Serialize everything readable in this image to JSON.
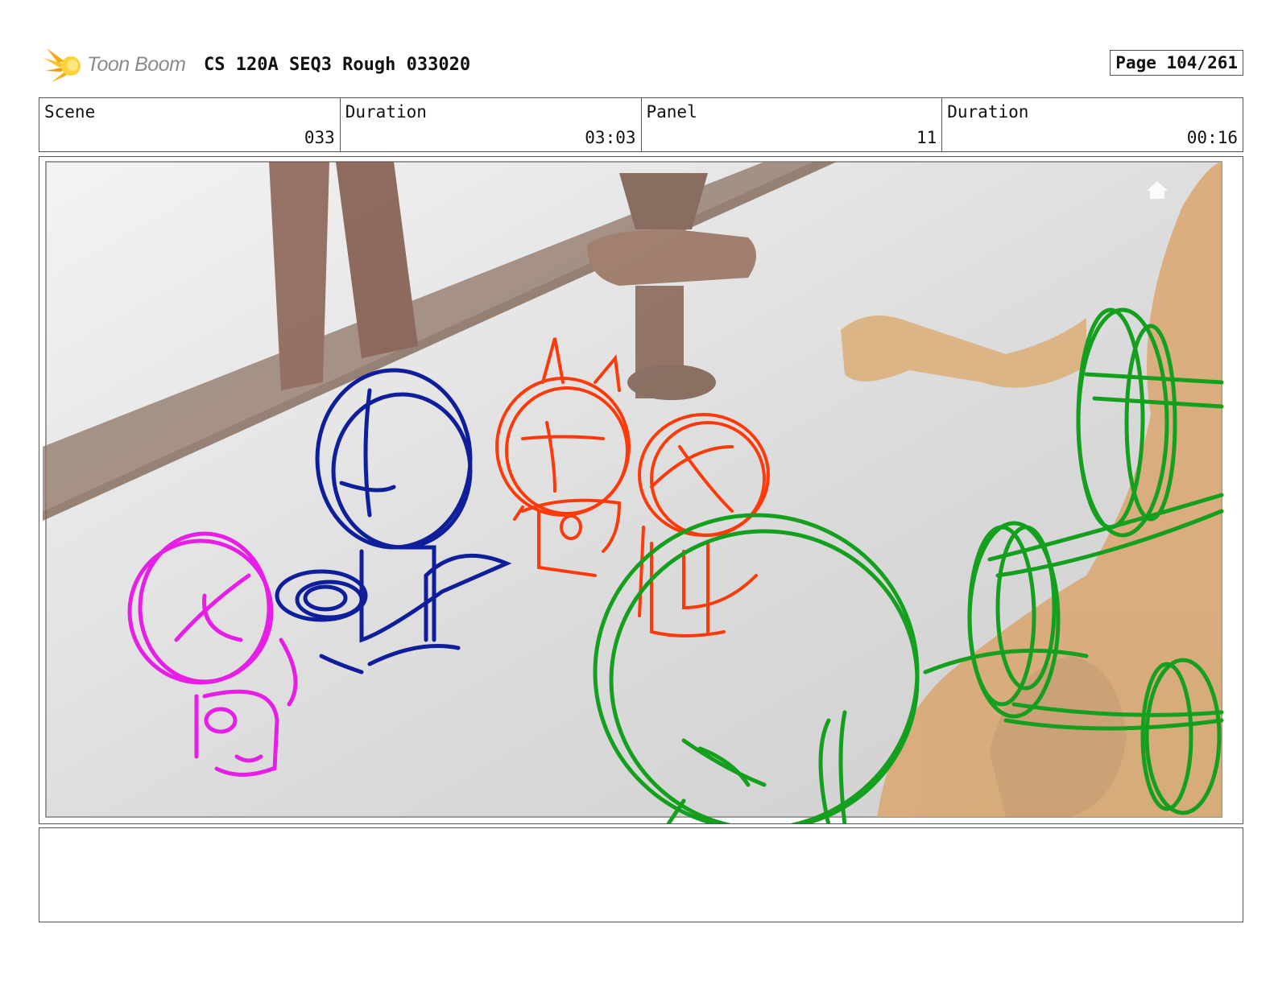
{
  "header": {
    "logo_text": "Toon Boom",
    "title": "CS 120A SEQ3 Rough 033020",
    "page": "Page 104/261"
  },
  "info": [
    {
      "label": "Scene",
      "value": "033"
    },
    {
      "label": "Duration",
      "value": "03:03"
    },
    {
      "label": "Panel",
      "value": "11"
    },
    {
      "label": "Duration",
      "value": "00:16"
    }
  ],
  "panel": {
    "colors": {
      "magenta_sketch": "#e61ee6",
      "blue_sketch": "#0f1e9b",
      "red_sketch": "#ff3a0a",
      "green_sketch": "#14a01e",
      "floor": "#d8d8d8",
      "wood": "#8a6a58",
      "character_tan": "#dcae78"
    },
    "icons": [
      "home-icon"
    ]
  },
  "notes": {
    "text": ""
  }
}
